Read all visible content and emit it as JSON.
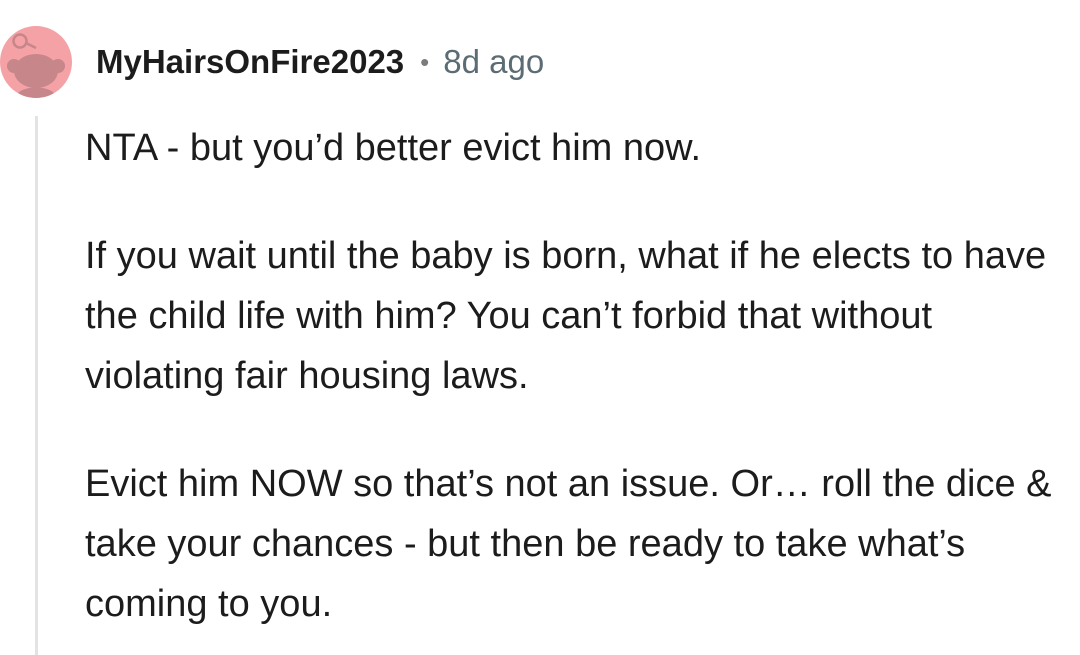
{
  "comment": {
    "author": "MyHairsOnFire2023",
    "separator": "•",
    "timestamp": "8d ago",
    "avatar": {
      "icon": "reddit-snoo-avatar-icon",
      "background_color": "#f5a2a6",
      "figure_color": "#c6868a"
    },
    "paragraphs": [
      "NTA - but you’d better evict him now.",
      "If you wait until the baby is born, what if he elects to have the child life with him?  You can’t forbid that without violating fair housing laws.",
      "Evict him NOW so that’s not an issue.  Or… roll the dice & take your chances - but then be ready to take what’s coming to you."
    ]
  },
  "colors": {
    "text": "#1c1c1c",
    "meta": "#5c6c74",
    "thread_line": "#e3e3e3"
  }
}
